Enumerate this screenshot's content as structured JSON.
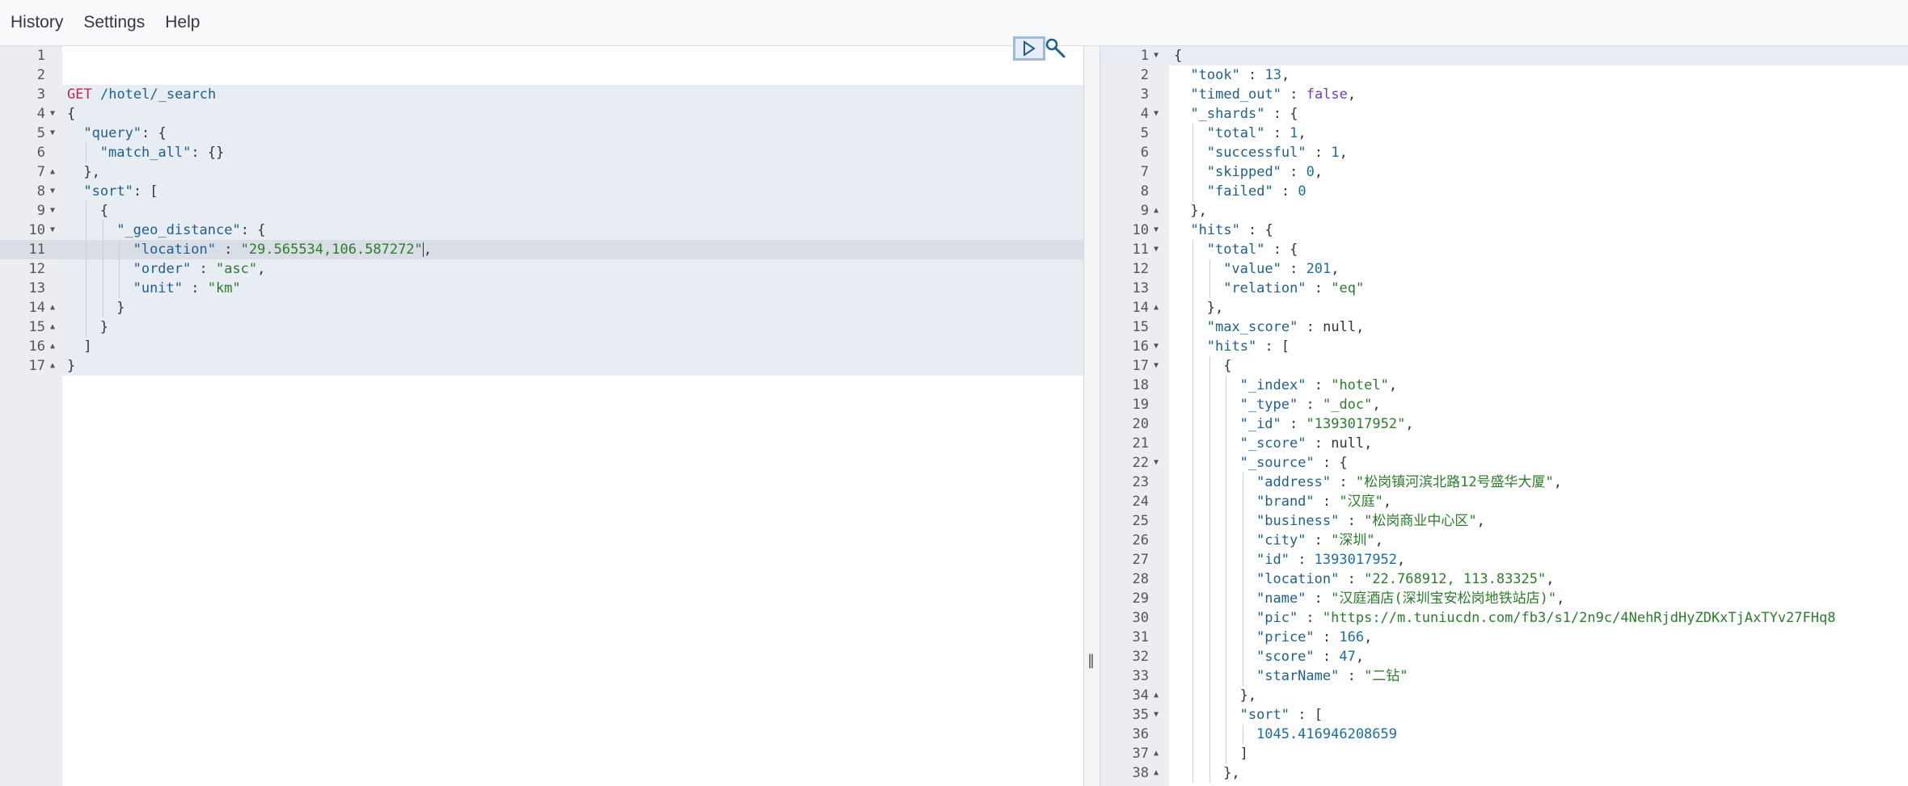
{
  "menu": [
    "History",
    "Settings",
    "Help"
  ],
  "colors": {
    "method": "#c7254e",
    "key": "#1f5f8b",
    "string": "#2b7d2b",
    "number": "#1a6fa0",
    "boolean": "#6a3fb5",
    "gutter": "#ebedf0",
    "active_block": "#e8ecf3",
    "current_line": "#d8dde6",
    "first_line": "#e8ecf3"
  },
  "icons": {
    "run": "play-icon",
    "settings": "wrench-icon",
    "fold_open": "fold-open-icon",
    "fold_close": "fold-close-icon",
    "resize": "resize-handle-icon"
  },
  "request": {
    "lines": [
      {
        "n": "1",
        "fold": "",
        "indent": 0,
        "toks": []
      },
      {
        "n": "2",
        "fold": "",
        "indent": 0,
        "toks": []
      },
      {
        "n": "3",
        "fold": "",
        "indent": 0,
        "toks": [
          [
            "m",
            "GET"
          ],
          [
            "p",
            " "
          ],
          [
            "u",
            "/hotel/_search"
          ]
        ]
      },
      {
        "n": "4",
        "fold": "▼",
        "indent": 0,
        "toks": [
          [
            "p",
            "{"
          ]
        ]
      },
      {
        "n": "5",
        "fold": "▼",
        "indent": 1,
        "toks": [
          [
            "k",
            "\"query\""
          ],
          [
            "p",
            ": {"
          ]
        ]
      },
      {
        "n": "6",
        "fold": "",
        "indent": 2,
        "toks": [
          [
            "k",
            "\"match_all\""
          ],
          [
            "p",
            ": {}"
          ]
        ]
      },
      {
        "n": "7",
        "fold": "▲",
        "indent": 1,
        "toks": [
          [
            "p",
            "},"
          ]
        ]
      },
      {
        "n": "8",
        "fold": "▼",
        "indent": 1,
        "toks": [
          [
            "k",
            "\"sort\""
          ],
          [
            "p",
            ": ["
          ]
        ]
      },
      {
        "n": "9",
        "fold": "▼",
        "indent": 2,
        "toks": [
          [
            "p",
            "{"
          ]
        ]
      },
      {
        "n": "10",
        "fold": "▼",
        "indent": 3,
        "toks": [
          [
            "k",
            "\"_geo_distance\""
          ],
          [
            "p",
            ": {"
          ]
        ]
      },
      {
        "n": "11",
        "fold": "",
        "indent": 4,
        "toks": [
          [
            "k",
            "\"location\""
          ],
          [
            "p",
            " : "
          ],
          [
            "s",
            "\"29.565534,106.587272\""
          ],
          [
            "c",
            ""
          ],
          [
            "p",
            ","
          ]
        ]
      },
      {
        "n": "12",
        "fold": "",
        "indent": 4,
        "toks": [
          [
            "k",
            "\"order\""
          ],
          [
            "p",
            " : "
          ],
          [
            "s",
            "\"asc\""
          ],
          [
            "p",
            ","
          ]
        ]
      },
      {
        "n": "13",
        "fold": "",
        "indent": 4,
        "toks": [
          [
            "k",
            "\"unit\""
          ],
          [
            "p",
            " : "
          ],
          [
            "s",
            "\"km\""
          ]
        ]
      },
      {
        "n": "14",
        "fold": "▲",
        "indent": 3,
        "toks": [
          [
            "p",
            "}"
          ]
        ]
      },
      {
        "n": "15",
        "fold": "▲",
        "indent": 2,
        "toks": [
          [
            "p",
            "}"
          ]
        ]
      },
      {
        "n": "16",
        "fold": "▲",
        "indent": 1,
        "toks": [
          [
            "p",
            "]"
          ]
        ]
      },
      {
        "n": "17",
        "fold": "▲",
        "indent": 0,
        "toks": [
          [
            "p",
            "}"
          ]
        ]
      }
    ]
  },
  "response": {
    "lines": [
      {
        "n": "1",
        "fold": "▼",
        "indent": 0,
        "toks": [
          [
            "p",
            "{"
          ]
        ]
      },
      {
        "n": "2",
        "fold": "",
        "indent": 1,
        "toks": [
          [
            "k",
            "\"took\""
          ],
          [
            "p",
            " : "
          ],
          [
            "n",
            "13"
          ],
          [
            "p",
            ","
          ]
        ]
      },
      {
        "n": "3",
        "fold": "",
        "indent": 1,
        "toks": [
          [
            "k",
            "\"timed_out\""
          ],
          [
            "p",
            " : "
          ],
          [
            "b",
            "false"
          ],
          [
            "p",
            ","
          ]
        ]
      },
      {
        "n": "4",
        "fold": "▼",
        "indent": 1,
        "toks": [
          [
            "k",
            "\"_shards\""
          ],
          [
            "p",
            " : {"
          ]
        ]
      },
      {
        "n": "5",
        "fold": "",
        "indent": 2,
        "toks": [
          [
            "k",
            "\"total\""
          ],
          [
            "p",
            " : "
          ],
          [
            "n",
            "1"
          ],
          [
            "p",
            ","
          ]
        ]
      },
      {
        "n": "6",
        "fold": "",
        "indent": 2,
        "toks": [
          [
            "k",
            "\"successful\""
          ],
          [
            "p",
            " : "
          ],
          [
            "n",
            "1"
          ],
          [
            "p",
            ","
          ]
        ]
      },
      {
        "n": "7",
        "fold": "",
        "indent": 2,
        "toks": [
          [
            "k",
            "\"skipped\""
          ],
          [
            "p",
            " : "
          ],
          [
            "n",
            "0"
          ],
          [
            "p",
            ","
          ]
        ]
      },
      {
        "n": "8",
        "fold": "",
        "indent": 2,
        "toks": [
          [
            "k",
            "\"failed\""
          ],
          [
            "p",
            " : "
          ],
          [
            "n",
            "0"
          ]
        ]
      },
      {
        "n": "9",
        "fold": "▲",
        "indent": 1,
        "toks": [
          [
            "p",
            "},"
          ]
        ]
      },
      {
        "n": "10",
        "fold": "▼",
        "indent": 1,
        "toks": [
          [
            "k",
            "\"hits\""
          ],
          [
            "p",
            " : {"
          ]
        ]
      },
      {
        "n": "11",
        "fold": "▼",
        "indent": 2,
        "toks": [
          [
            "k",
            "\"total\""
          ],
          [
            "p",
            " : {"
          ]
        ]
      },
      {
        "n": "12",
        "fold": "",
        "indent": 3,
        "toks": [
          [
            "k",
            "\"value\""
          ],
          [
            "p",
            " : "
          ],
          [
            "n",
            "201"
          ],
          [
            "p",
            ","
          ]
        ]
      },
      {
        "n": "13",
        "fold": "",
        "indent": 3,
        "toks": [
          [
            "k",
            "\"relation\""
          ],
          [
            "p",
            " : "
          ],
          [
            "s",
            "\"eq\""
          ]
        ]
      },
      {
        "n": "14",
        "fold": "▲",
        "indent": 2,
        "toks": [
          [
            "p",
            "},"
          ]
        ]
      },
      {
        "n": "15",
        "fold": "",
        "indent": 2,
        "toks": [
          [
            "k",
            "\"max_score\""
          ],
          [
            "p",
            " : "
          ],
          [
            "z",
            "null"
          ],
          [
            "p",
            ","
          ]
        ]
      },
      {
        "n": "16",
        "fold": "▼",
        "indent": 2,
        "toks": [
          [
            "k",
            "\"hits\""
          ],
          [
            "p",
            " : ["
          ]
        ]
      },
      {
        "n": "17",
        "fold": "▼",
        "indent": 3,
        "toks": [
          [
            "p",
            "{"
          ]
        ]
      },
      {
        "n": "18",
        "fold": "",
        "indent": 4,
        "toks": [
          [
            "k",
            "\"_index\""
          ],
          [
            "p",
            " : "
          ],
          [
            "s",
            "\"hotel\""
          ],
          [
            "p",
            ","
          ]
        ]
      },
      {
        "n": "19",
        "fold": "",
        "indent": 4,
        "toks": [
          [
            "k",
            "\"_type\""
          ],
          [
            "p",
            " : "
          ],
          [
            "s",
            "\"_doc\""
          ],
          [
            "p",
            ","
          ]
        ]
      },
      {
        "n": "20",
        "fold": "",
        "indent": 4,
        "toks": [
          [
            "k",
            "\"_id\""
          ],
          [
            "p",
            " : "
          ],
          [
            "s",
            "\"1393017952\""
          ],
          [
            "p",
            ","
          ]
        ]
      },
      {
        "n": "21",
        "fold": "",
        "indent": 4,
        "toks": [
          [
            "k",
            "\"_score\""
          ],
          [
            "p",
            " : "
          ],
          [
            "z",
            "null"
          ],
          [
            "p",
            ","
          ]
        ]
      },
      {
        "n": "22",
        "fold": "▼",
        "indent": 4,
        "toks": [
          [
            "k",
            "\"_source\""
          ],
          [
            "p",
            " : {"
          ]
        ]
      },
      {
        "n": "23",
        "fold": "",
        "indent": 5,
        "toks": [
          [
            "k",
            "\"address\""
          ],
          [
            "p",
            " : "
          ],
          [
            "s",
            "\"松岗镇河滨北路12号盛华大厦\""
          ],
          [
            "p",
            ","
          ]
        ]
      },
      {
        "n": "24",
        "fold": "",
        "indent": 5,
        "toks": [
          [
            "k",
            "\"brand\""
          ],
          [
            "p",
            " : "
          ],
          [
            "s",
            "\"汉庭\""
          ],
          [
            "p",
            ","
          ]
        ]
      },
      {
        "n": "25",
        "fold": "",
        "indent": 5,
        "toks": [
          [
            "k",
            "\"business\""
          ],
          [
            "p",
            " : "
          ],
          [
            "s",
            "\"松岗商业中心区\""
          ],
          [
            "p",
            ","
          ]
        ]
      },
      {
        "n": "26",
        "fold": "",
        "indent": 5,
        "toks": [
          [
            "k",
            "\"city\""
          ],
          [
            "p",
            " : "
          ],
          [
            "s",
            "\"深圳\""
          ],
          [
            "p",
            ","
          ]
        ]
      },
      {
        "n": "27",
        "fold": "",
        "indent": 5,
        "toks": [
          [
            "k",
            "\"id\""
          ],
          [
            "p",
            " : "
          ],
          [
            "n",
            "1393017952"
          ],
          [
            "p",
            ","
          ]
        ]
      },
      {
        "n": "28",
        "fold": "",
        "indent": 5,
        "toks": [
          [
            "k",
            "\"location\""
          ],
          [
            "p",
            " : "
          ],
          [
            "s",
            "\"22.768912, 113.83325\""
          ],
          [
            "p",
            ","
          ]
        ]
      },
      {
        "n": "29",
        "fold": "",
        "indent": 5,
        "toks": [
          [
            "k",
            "\"name\""
          ],
          [
            "p",
            " : "
          ],
          [
            "s",
            "\"汉庭酒店(深圳宝安松岗地铁站店)\""
          ],
          [
            "p",
            ","
          ]
        ]
      },
      {
        "n": "30",
        "fold": "",
        "indent": 5,
        "toks": [
          [
            "k",
            "\"pic\""
          ],
          [
            "p",
            " : "
          ],
          [
            "s",
            "\"https://m.tuniucdn.com/fb3/s1/2n9c/4NehRjdHyZDKxTjAxTYv27FHq8"
          ]
        ]
      },
      {
        "n": "31",
        "fold": "",
        "indent": 5,
        "toks": [
          [
            "k",
            "\"price\""
          ],
          [
            "p",
            " : "
          ],
          [
            "n",
            "166"
          ],
          [
            "p",
            ","
          ]
        ]
      },
      {
        "n": "32",
        "fold": "",
        "indent": 5,
        "toks": [
          [
            "k",
            "\"score\""
          ],
          [
            "p",
            " : "
          ],
          [
            "n",
            "47"
          ],
          [
            "p",
            ","
          ]
        ]
      },
      {
        "n": "33",
        "fold": "",
        "indent": 5,
        "toks": [
          [
            "k",
            "\"starName\""
          ],
          [
            "p",
            " : "
          ],
          [
            "s",
            "\"二钻\""
          ]
        ]
      },
      {
        "n": "34",
        "fold": "▲",
        "indent": 4,
        "toks": [
          [
            "p",
            "},"
          ]
        ]
      },
      {
        "n": "35",
        "fold": "▼",
        "indent": 4,
        "toks": [
          [
            "k",
            "\"sort\""
          ],
          [
            "p",
            " : ["
          ]
        ]
      },
      {
        "n": "36",
        "fold": "",
        "indent": 5,
        "toks": [
          [
            "n",
            "1045.416946208659"
          ]
        ]
      },
      {
        "n": "37",
        "fold": "▲",
        "indent": 4,
        "toks": [
          [
            "p",
            "]"
          ]
        ]
      },
      {
        "n": "38",
        "fold": "▲",
        "indent": 3,
        "toks": [
          [
            "p",
            "},"
          ]
        ]
      }
    ]
  }
}
